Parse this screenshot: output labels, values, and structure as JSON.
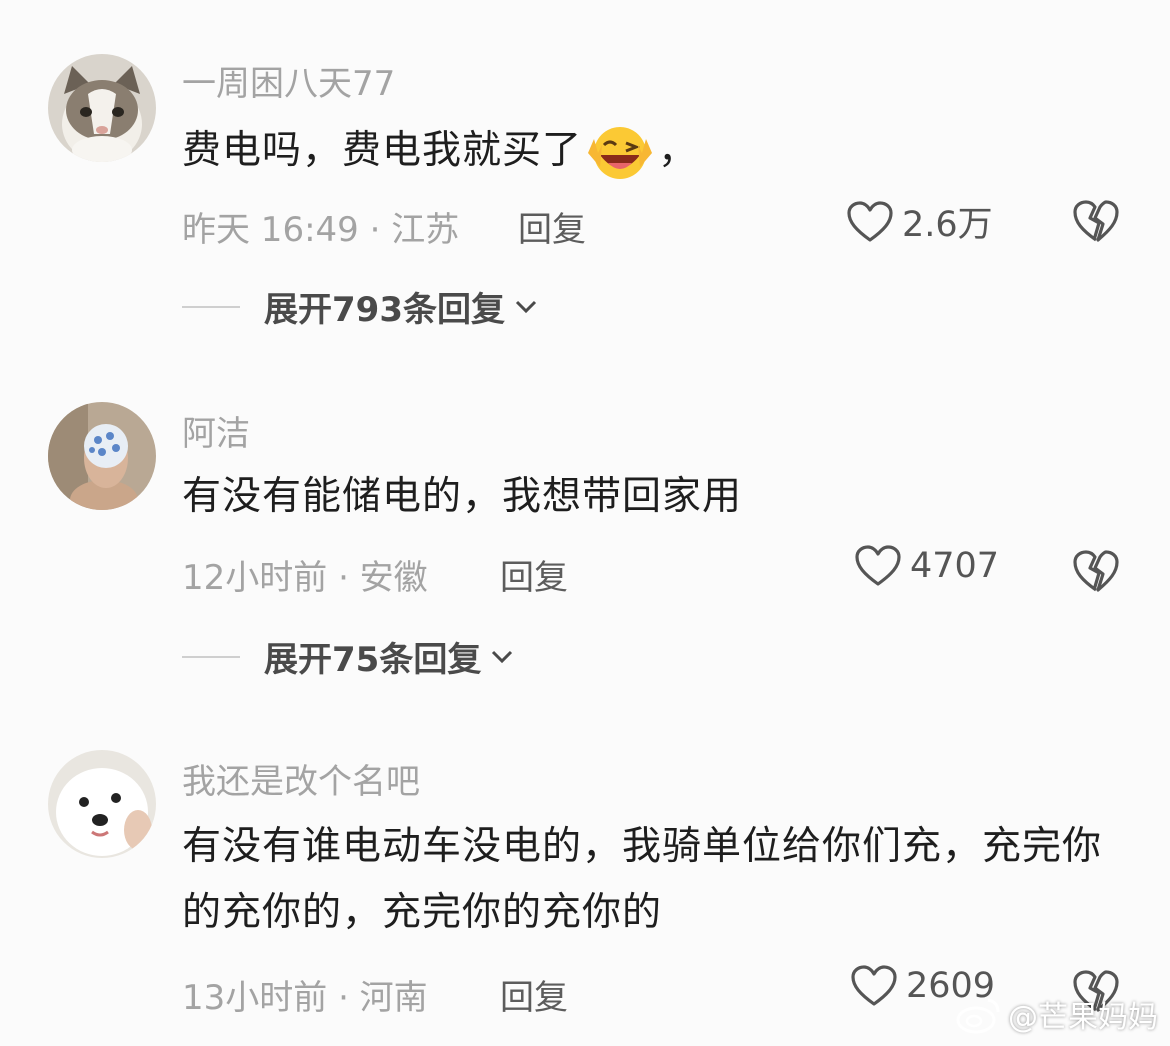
{
  "comments": [
    {
      "username": "一周困八天77",
      "content_before": "费电吗，费电我就买了",
      "content_after": "，",
      "time_location": "昨天 16:49 · 江苏",
      "reply_label": "回复",
      "likes": "2.6万",
      "expand_label": "展开793条回复",
      "avatar_icon": "cat-avatar",
      "emoji_icon": "grinning-wink-emoji"
    },
    {
      "username": "阿洁",
      "content": "有没有能储电的，我想带回家用",
      "time_location": "12小时前 · 安徽",
      "reply_label": "回复",
      "likes": "4707",
      "expand_label": "展开75条回复",
      "avatar_icon": "person-avatar"
    },
    {
      "username": "我还是改个名吧",
      "content": "有没有谁电动车没电的，我骑单位给你们充，充完你的充你的，充完你的充你的",
      "time_location": "13小时前 · 河南",
      "reply_label": "回复",
      "likes": "2609",
      "avatar_icon": "dog-avatar"
    }
  ],
  "watermark": {
    "text": "@芒果妈妈",
    "icon": "weibo-icon"
  }
}
